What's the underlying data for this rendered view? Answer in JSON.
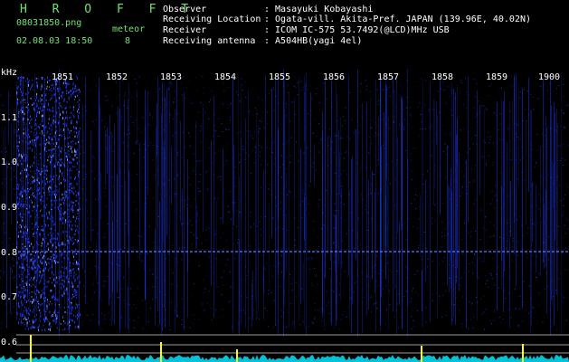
{
  "header": {
    "app_title": "H R O F F T",
    "file_name": "08031850.png",
    "datetime": "02.08.03 18:50",
    "meteor_label": "meteor",
    "meteor_count": "8",
    "fields": [
      {
        "label": "Observer",
        "value": ": Masayuki Kobayashi"
      },
      {
        "label": "Receiving Location",
        "value": ": Ogata-vill. Akita-Pref. JAPAN (139.96E, 40.02N)"
      },
      {
        "label": "Receiver",
        "value": ": ICOM IC-575 53.7492(@LCD)MHz USB"
      },
      {
        "label": "Receiving antenna",
        "value": ": A504HB(yagi 4el)"
      }
    ]
  },
  "spectrogram": {
    "y_unit": "kHz",
    "y_ticks": [
      "1.1",
      "1.0",
      "0.9",
      "0.8",
      "0.7",
      "0.6"
    ],
    "x_ticks": [
      "1851",
      "1852",
      "1853",
      "1854",
      "1855",
      "1856",
      "1857",
      "1858",
      "1859",
      "1900"
    ],
    "colors": {
      "background": "#000000",
      "signal": "#1e3cff",
      "trace": "#00e5ff",
      "marker": "#ffff00"
    }
  }
}
